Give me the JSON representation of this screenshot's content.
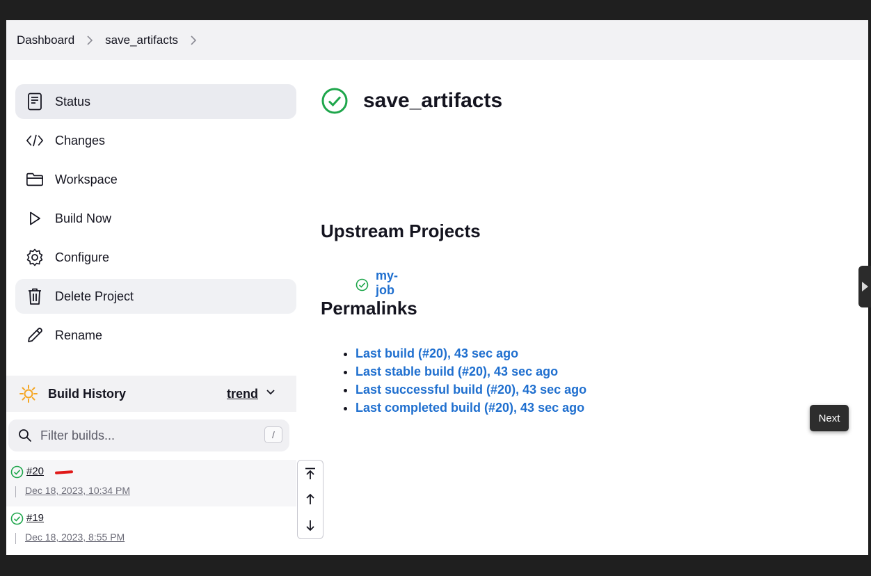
{
  "breadcrumb": {
    "items": [
      "Dashboard",
      "save_artifacts"
    ]
  },
  "sidebar": {
    "items": [
      {
        "label": "Status",
        "icon": "document-icon"
      },
      {
        "label": "Changes",
        "icon": "code-icon"
      },
      {
        "label": "Workspace",
        "icon": "folder-icon"
      },
      {
        "label": "Build Now",
        "icon": "play-icon"
      },
      {
        "label": "Configure",
        "icon": "gear-icon"
      },
      {
        "label": "Delete Project",
        "icon": "trash-icon"
      },
      {
        "label": "Rename",
        "icon": "pencil-icon"
      }
    ]
  },
  "build_history": {
    "title": "Build History",
    "trend_label": "trend",
    "filter_placeholder": "Filter builds...",
    "shortcut": "/",
    "builds": [
      {
        "number": "#20",
        "date": "Dec 18, 2023, 10:34 PM",
        "status": "success"
      },
      {
        "number": "#19",
        "date": "Dec 18, 2023, 8:55 PM",
        "status": "success"
      }
    ]
  },
  "main": {
    "title": "save_artifacts",
    "upstream_heading": "Upstream Projects",
    "upstream_projects": [
      "my-job"
    ],
    "permalinks_heading": "Permalinks",
    "permalinks": [
      "Last build (#20), 43 sec ago",
      "Last stable build (#20), 43 sec ago",
      "Last successful build (#20), 43 sec ago",
      "Last completed build (#20), 43 sec ago"
    ]
  },
  "overlay": {
    "next_label": "Next"
  },
  "colors": {
    "success": "#1ea64b",
    "link": "#1f6fcf",
    "accent_sun": "#f5a623",
    "annotation": "#e01818"
  }
}
